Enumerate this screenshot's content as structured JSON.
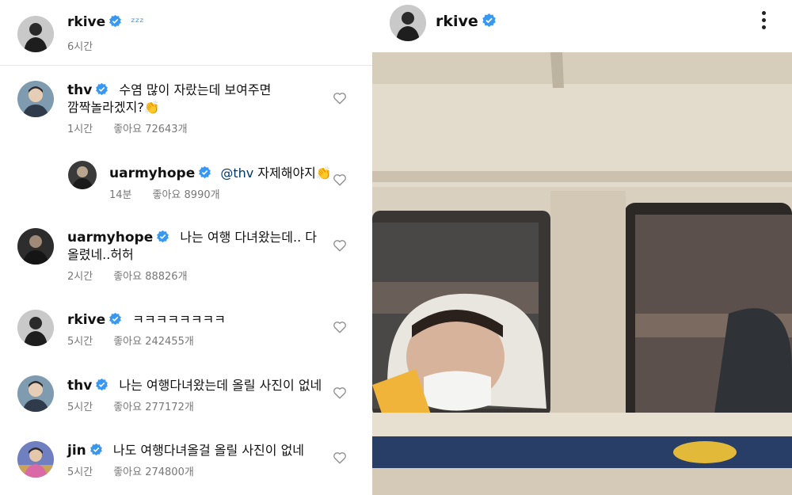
{
  "post": {
    "author": "rkive",
    "caption": "ᶻᶻᶻ",
    "time": "6시간"
  },
  "header": {
    "username": "rkive"
  },
  "comments": [
    {
      "user": "thv",
      "line1": "수염 많이 자랐는데 보여주면",
      "line2": "깜짝놀라겠지?👏",
      "time": "1시간",
      "likes": "좋아요 72643개"
    },
    {
      "user": "uarmyhope",
      "mention": "@thv",
      "line1": " 자제해야지👏",
      "time": "14분",
      "likes": "좋아요 8990개"
    },
    {
      "user": "uarmyhope",
      "line1": "나는 여행 다녀왔는데.. 다",
      "line2": "올렸네..허허",
      "time": "2시간",
      "likes": "좋아요 88826개"
    },
    {
      "user": "rkive",
      "line1": "ㅋㅋㅋㅋㅋㅋㅋㅋ",
      "time": "5시간",
      "likes": "좋아요 242455개"
    },
    {
      "user": "thv",
      "line1": "나는 여행다녀왔는데 올릴 사진이 없네",
      "time": "5시간",
      "likes": "좋아요 277172개"
    },
    {
      "user": "jin",
      "line1": "나도 여행다녀올걸 올릴 사진이 없네",
      "time": "5시간",
      "likes": "좋아요 274800개"
    }
  ],
  "colors": {
    "verified": "#3897f0",
    "meta": "#777777",
    "mention": "#00376b"
  },
  "icons": {
    "verified": "verified-badge-icon",
    "like": "heart-outline-icon",
    "more": "more-vertical-icon"
  }
}
